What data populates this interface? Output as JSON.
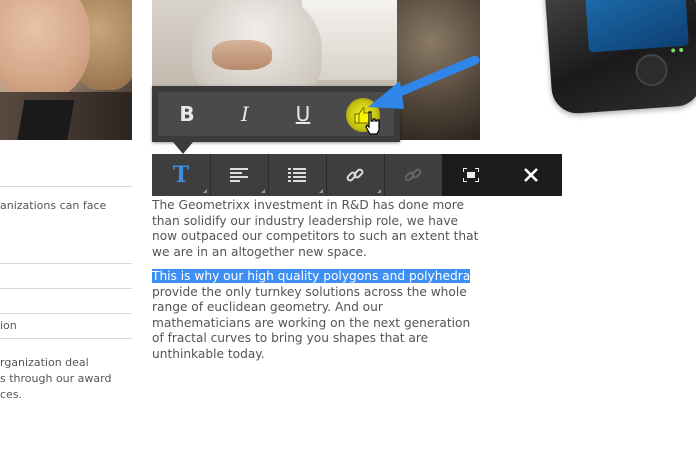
{
  "left_column": {
    "line1": "anizations can face",
    "line2": "ion",
    "line3": "rganization deal",
    "line4": "s through our award",
    "line5": "ces."
  },
  "inline_toolbar": {
    "bold_label": "B",
    "italic_label": "I",
    "underline_label": "U"
  },
  "main_toolbar": {
    "text_label": "T"
  },
  "content": {
    "para1": [
      "The Geometrixx investment in R&D has done more",
      "than solidify our industry leadership role, we have",
      "now outpaced our competitors to such an extent that",
      "we are in an altogether new space."
    ],
    "highlight": "This is why our high quality polygons and polyhedra",
    "para2": [
      "provide the only turnkey solutions across the whole",
      "range of euclidean geometry. And our",
      "mathematicians are working on the next generation",
      "of fractal curves to bring you shapes that are",
      "unthinkable today."
    ]
  },
  "colors": {
    "toolbar_bg": "#3e3e3e",
    "highlight": "#3d8ff5",
    "active_icon": "#3c8fe0",
    "arrow": "#2f86e8",
    "thumb": "#f1f02a"
  }
}
